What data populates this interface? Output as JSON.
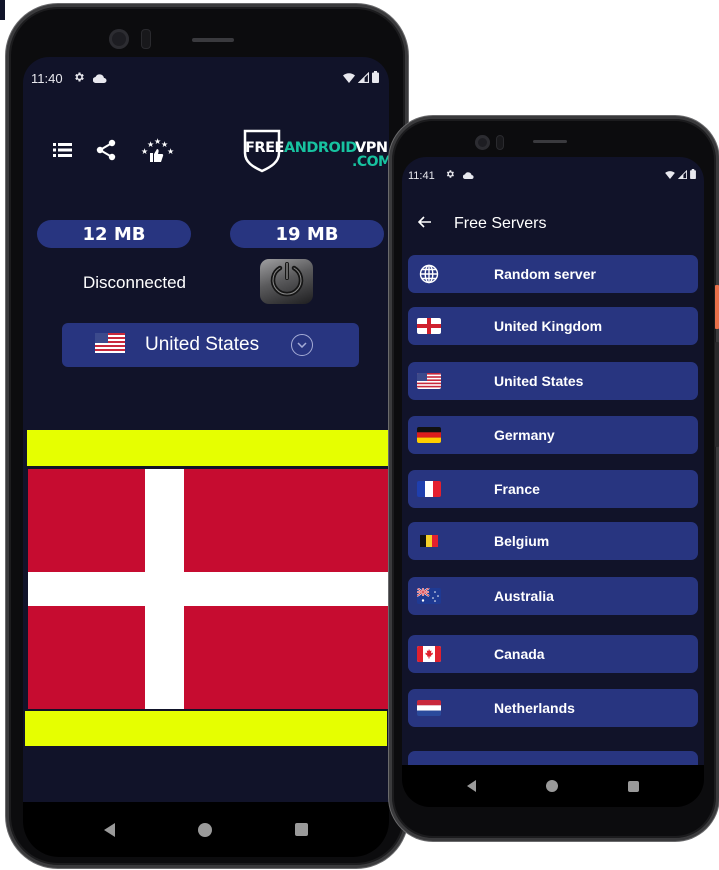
{
  "left_phone": {
    "status_bar": {
      "time": "11:40",
      "icons": [
        "settings-icon",
        "cloud-icon",
        "wifi-icon",
        "signal-icon",
        "battery-icon"
      ]
    },
    "toolbar": {
      "icons": [
        "menu-list-icon",
        "share-icon",
        "rate-stars-icon"
      ]
    },
    "logo": {
      "part_free": "FREE",
      "part_android": "ANDROID",
      "part_vpn": "VPN",
      "part_com": ".COM"
    },
    "data_usage": {
      "download": "12 MB",
      "upload": "19 MB"
    },
    "connection_status": "Disconnected",
    "power_button": {
      "icon": "power-icon"
    },
    "country_selector": {
      "flag": "us-flag",
      "country": "United States",
      "icon": "chevron-down-icon"
    },
    "ad_banner": {
      "flag": "denmark-flag",
      "banner_color": "#e6ff00"
    },
    "nav_bar": [
      "back",
      "home",
      "recents"
    ]
  },
  "right_phone": {
    "status_bar": {
      "time": "11:41",
      "icons": [
        "settings-icon",
        "cloud-icon",
        "wifi-icon",
        "signal-icon",
        "battery-icon"
      ]
    },
    "app_bar": {
      "title": "Free Servers",
      "back_icon": "arrow-left-icon"
    },
    "servers": [
      {
        "label": "Random server",
        "icon": "globe"
      },
      {
        "label": "United Kingdom",
        "icon": "gb"
      },
      {
        "label": "United States",
        "icon": "us"
      },
      {
        "label": "Germany",
        "icon": "de"
      },
      {
        "label": "France",
        "icon": "fr"
      },
      {
        "label": "Belgium",
        "icon": "be"
      },
      {
        "label": "Australia",
        "icon": "au"
      },
      {
        "label": "Canada",
        "icon": "ca"
      },
      {
        "label": "Netherlands",
        "icon": "nl"
      }
    ],
    "nav_bar": [
      "back",
      "home",
      "recents"
    ]
  },
  "colors": {
    "screen_bg": "#111329",
    "card_bg": "#283580",
    "accent_teal": "#17c2a0",
    "text": "#ffffff"
  }
}
